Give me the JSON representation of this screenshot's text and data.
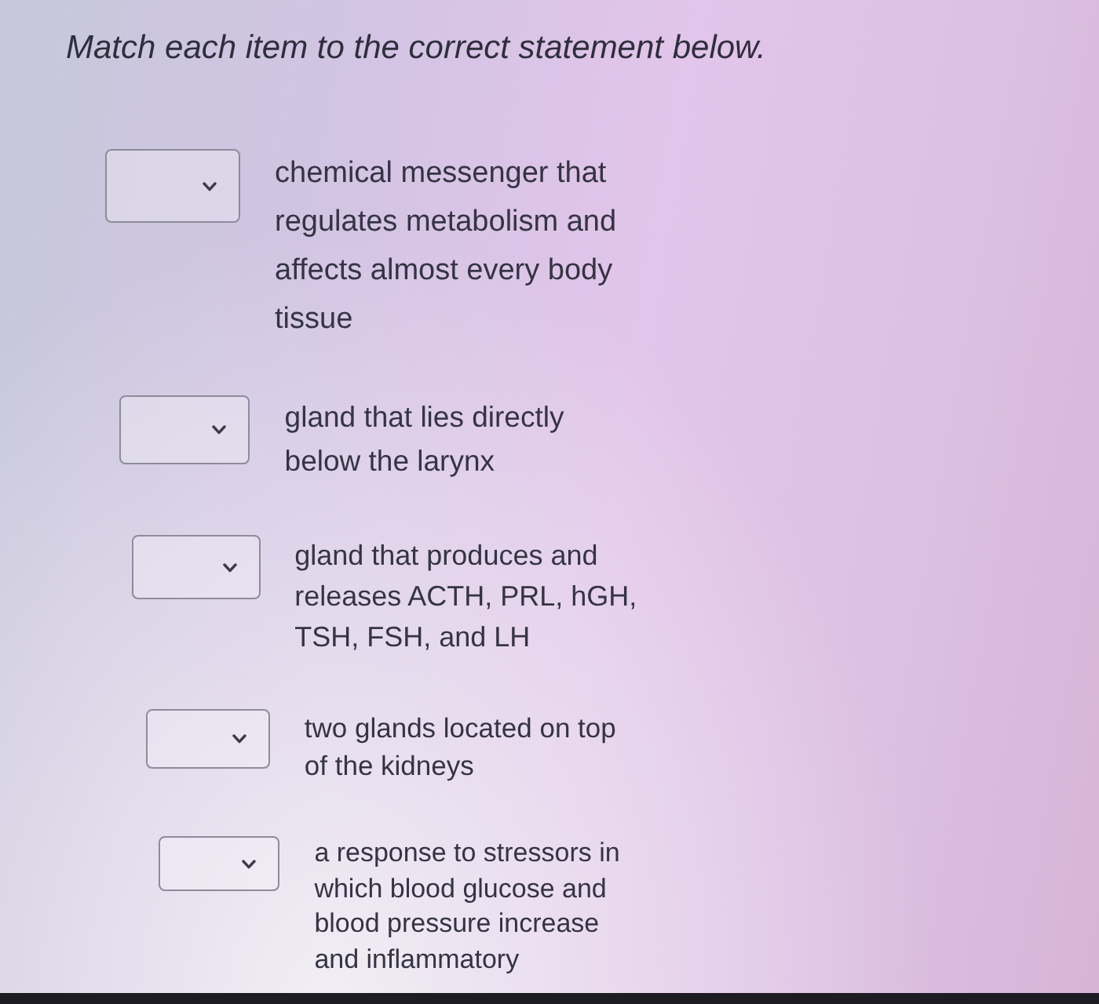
{
  "instruction": "Match each item to the correct statement below.",
  "items": [
    {
      "statement": "chemical messenger that regulates metabolism and affects almost every body tissue"
    },
    {
      "statement": "gland that lies directly below the larynx"
    },
    {
      "statement": "gland that produces and releases ACTH, PRL, hGH, TSH, FSH, and LH"
    },
    {
      "statement": "two glands located on top of the kidneys"
    },
    {
      "statement": "a response to stressors in which blood glucose and blood pressure increase and inflammatory"
    }
  ]
}
